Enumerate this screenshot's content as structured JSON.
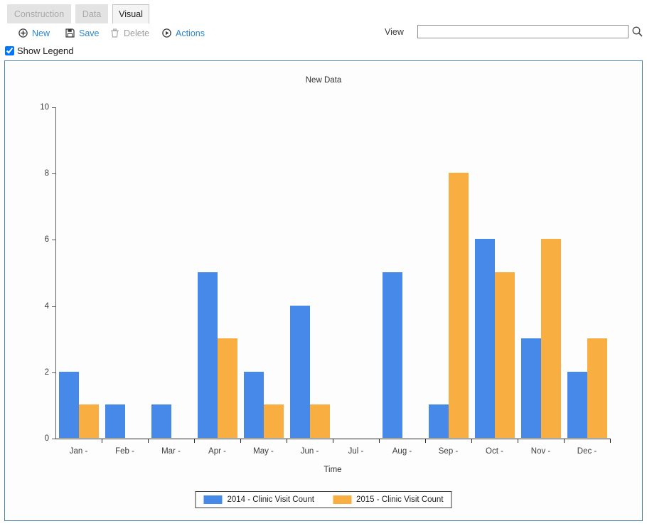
{
  "tabs": [
    {
      "label": "Construction",
      "active": false,
      "enabled": false
    },
    {
      "label": "Data",
      "active": false,
      "enabled": false
    },
    {
      "label": "Visual",
      "active": true,
      "enabled": true
    }
  ],
  "toolbar": {
    "new_label": "New",
    "save_label": "Save",
    "delete_label": "Delete",
    "actions_label": "Actions",
    "new_icon": "plus-circle-icon",
    "save_icon": "floppy-disk-icon",
    "delete_icon": "trash-can-icon",
    "actions_icon": "play-circle-icon",
    "link_color": "#2e86c8",
    "disabled_color": "#9b9b9b"
  },
  "view": {
    "label": "View",
    "value": "",
    "placeholder": "",
    "search_icon": "magnifier-icon"
  },
  "options": {
    "show_legend_label": "Show Legend",
    "show_legend_checked": true
  },
  "panel": {
    "border_color": "#4d87b0"
  },
  "chart_data": {
    "type": "bar",
    "title": "New Data",
    "xlabel": "Time",
    "ylabel": "",
    "categories": [
      "Jan -",
      "Feb -",
      "Mar -",
      "Apr -",
      "May -",
      "Jun -",
      "Jul -",
      "Aug -",
      "Sep -",
      "Oct -",
      "Nov -",
      "Dec -"
    ],
    "series": [
      {
        "name": "2014 - Clinic Visit Count",
        "color": "#4689e8",
        "values": [
          2,
          1,
          1,
          5,
          2,
          4,
          0,
          5,
          1,
          6,
          3,
          2
        ]
      },
      {
        "name": "2015 - Clinic Visit Count",
        "color": "#f9ae41",
        "values": [
          1,
          0,
          0,
          3,
          1,
          1,
          0,
          0,
          8,
          5,
          6,
          3
        ]
      }
    ],
    "ylim": [
      0,
      10
    ],
    "yticks": [
      0,
      2,
      4,
      6,
      8,
      10
    ],
    "grid": false,
    "legend_position": "bottom"
  }
}
